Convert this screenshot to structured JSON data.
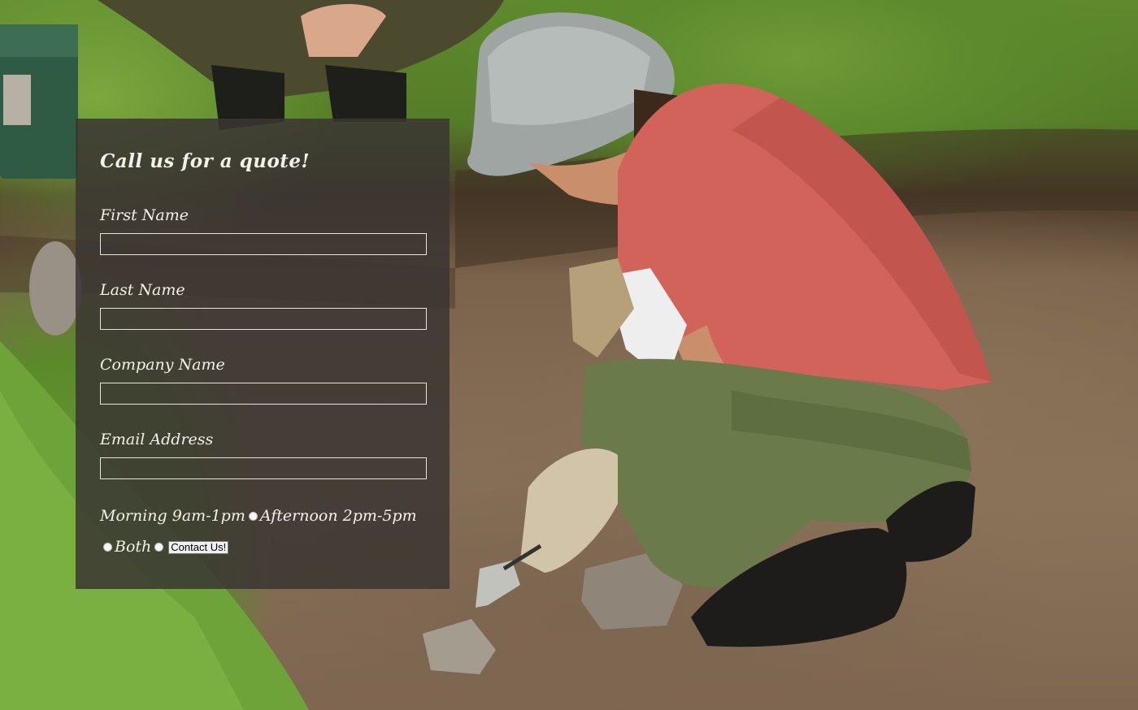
{
  "form": {
    "title": "Call us for a quote!",
    "fields": [
      {
        "label": "First Name",
        "value": ""
      },
      {
        "label": "Last Name",
        "value": ""
      },
      {
        "label": "Company Name",
        "value": ""
      },
      {
        "label": "Email Address",
        "value": ""
      }
    ],
    "time_options": [
      {
        "label": "Morning 9am-1pm",
        "selected": false
      },
      {
        "label": "Afternoon 2pm-5pm",
        "selected": false
      },
      {
        "label": "Both",
        "selected": false
      }
    ],
    "submit_label": "Contact Us!"
  },
  "colors": {
    "panel_background": "#3a3632",
    "panel_text": "#f3f0ea",
    "field_border": "#e8e4dc"
  },
  "icons": [
    "background-photo-archaeologist"
  ]
}
